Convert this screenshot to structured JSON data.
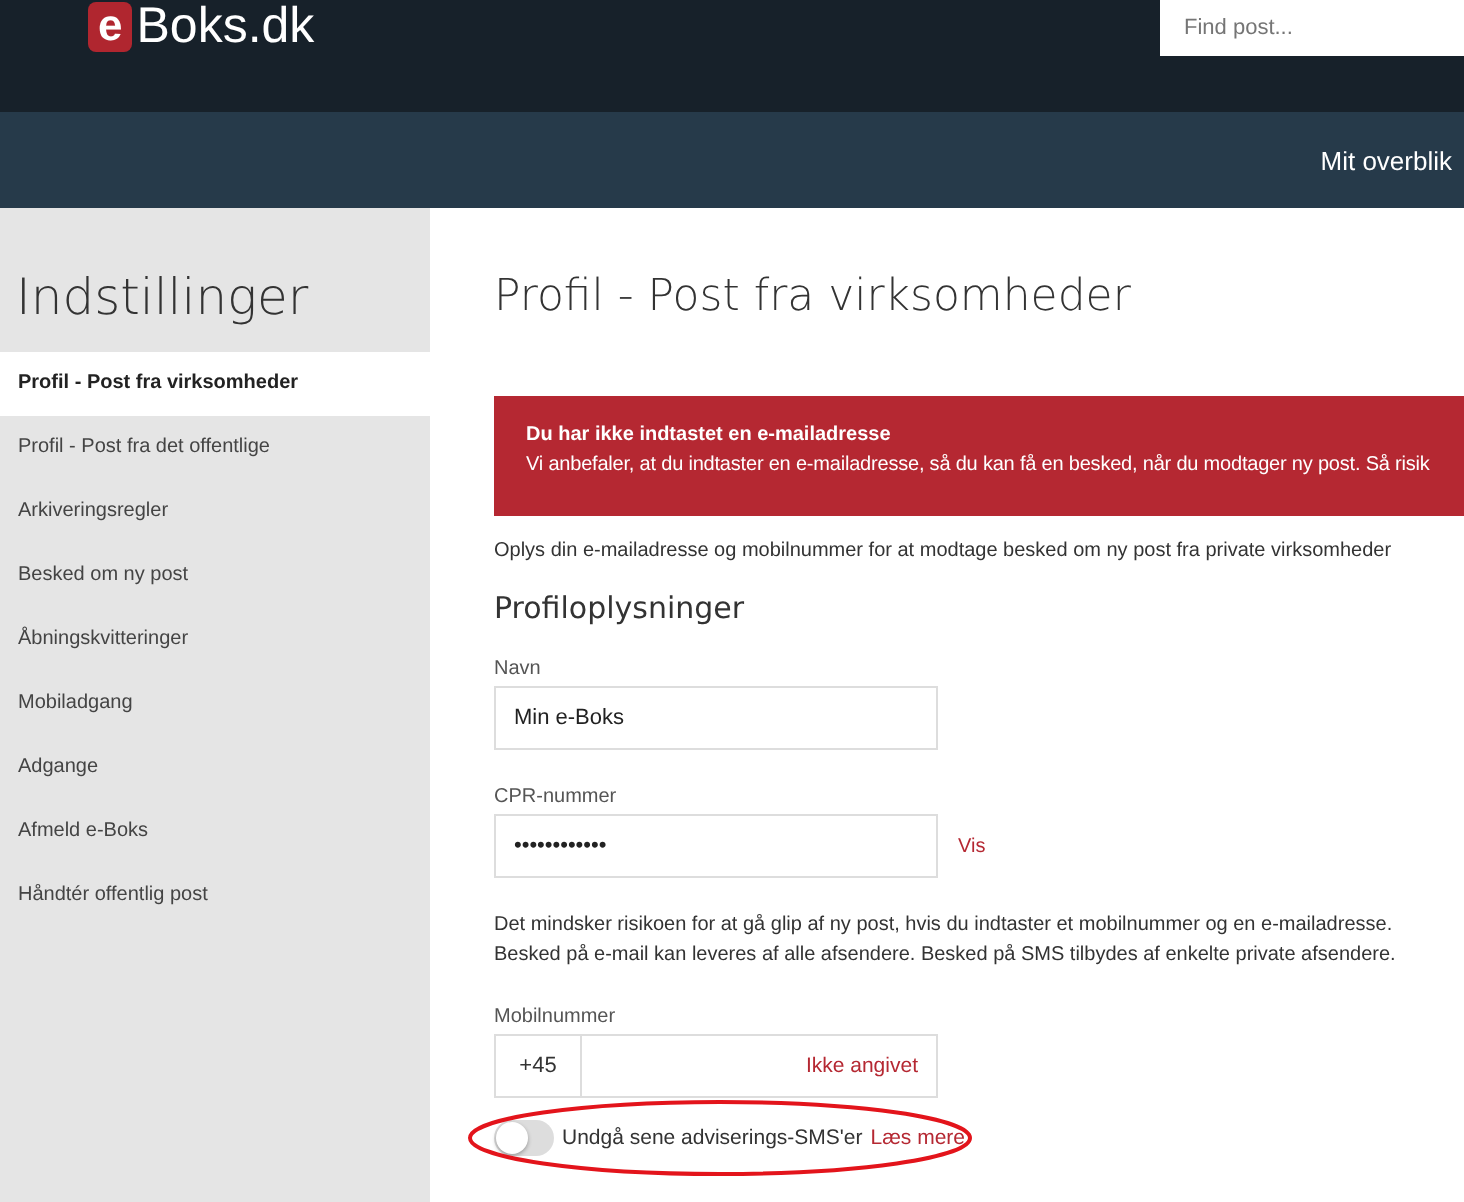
{
  "header": {
    "logo_mark": "e",
    "logo_text": "Boks.dk",
    "search": {
      "placeholder": "Find post..."
    }
  },
  "nav": {
    "items": [
      {
        "label": "Mit overblik"
      }
    ]
  },
  "sidebar": {
    "title": "Indstillinger",
    "items": [
      {
        "label": "Profil - Post fra virksomheder",
        "selected": true
      },
      {
        "label": "Profil - Post fra det offentlige",
        "selected": false
      },
      {
        "label": "Arkiveringsregler",
        "selected": false
      },
      {
        "label": "Besked om ny post",
        "selected": false
      },
      {
        "label": "Åbningskvitteringer",
        "selected": false
      },
      {
        "label": "Mobiladgang",
        "selected": false
      },
      {
        "label": "Adgange",
        "selected": false
      },
      {
        "label": "Afmeld e-Boks",
        "selected": false
      },
      {
        "label": "Håndtér offentlig post",
        "selected": false
      }
    ]
  },
  "page": {
    "title": "Profil - Post fra virksomheder",
    "alert": {
      "title": "Du har ikke indtastet en e-mailadresse",
      "text": "Vi anbefaler, at du indtaster en e-mailadresse, så du kan få en besked, når du modtager ny post. Så risik"
    },
    "intro": "Oplys din e-mailadresse og mobilnummer for at modtage besked om ny post fra private virksomheder",
    "section_title": "Profiloplysninger",
    "name_field": {
      "label": "Navn",
      "value": "Min e-Boks"
    },
    "cpr_field": {
      "label": "CPR-nummer",
      "value": "••••••••••••",
      "link": "Vis"
    },
    "info": [
      "Det mindsker risikoen for at gå glip af ny post, hvis du indtaster et mobilnummer og en e-mailadresse.",
      "Besked på e-mail kan leveres af alle afsendere. Besked på SMS tilbydes af enkelte private afsendere."
    ],
    "mobile_field": {
      "label": "Mobilnummer",
      "prefix": "+45",
      "placeholder": "Ikke angivet"
    },
    "toggle": {
      "label": "Undgå sene adviserings-SMS'er",
      "checked": false,
      "link": "Læs mere"
    },
    "annotation": {
      "kind": "ellipse",
      "color": "#e3141b"
    }
  }
}
